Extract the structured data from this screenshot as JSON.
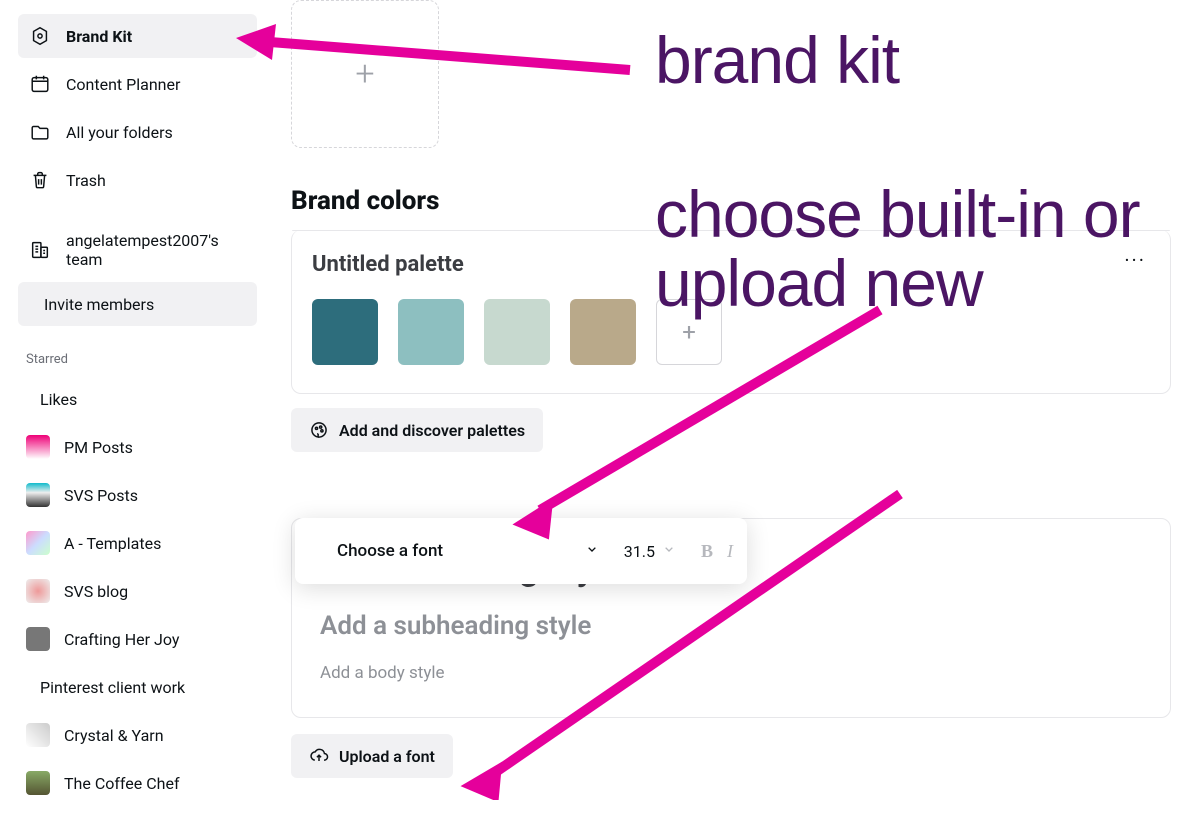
{
  "sidebar": {
    "items": [
      {
        "label": "Brand Kit"
      },
      {
        "label": "Content Planner"
      },
      {
        "label": "All your folders"
      },
      {
        "label": "Trash"
      }
    ],
    "team_label": "angelatempest2007's team",
    "invite_label": "Invite members",
    "starred_heading": "Starred",
    "starred": [
      {
        "label": "Likes"
      },
      {
        "label": "PM Posts"
      },
      {
        "label": "SVS Posts"
      },
      {
        "label": "A - Templates"
      },
      {
        "label": "SVS blog"
      },
      {
        "label": "Crafting Her Joy"
      },
      {
        "label": "Pinterest client work"
      },
      {
        "label": "Crystal & Yarn"
      },
      {
        "label": "The Coffee Chef"
      }
    ]
  },
  "main": {
    "colors_title": "Brand colors",
    "palette_name": "Untitled palette",
    "palette": [
      "#2d6d7c",
      "#8dbfc0",
      "#c7d9cf",
      "#b9a98a"
    ],
    "discover_label": "Add and discover palettes",
    "font_picker": {
      "label": "Choose a font",
      "size": "31.5"
    },
    "text_styles": {
      "heading": "Add a heading style",
      "sub": "Add a subheading style",
      "body": "Add a body style"
    },
    "upload_font_label": "Upload a font"
  },
  "annotations": {
    "a1": "brand kit",
    "a2": "choose built-in or upload new"
  }
}
